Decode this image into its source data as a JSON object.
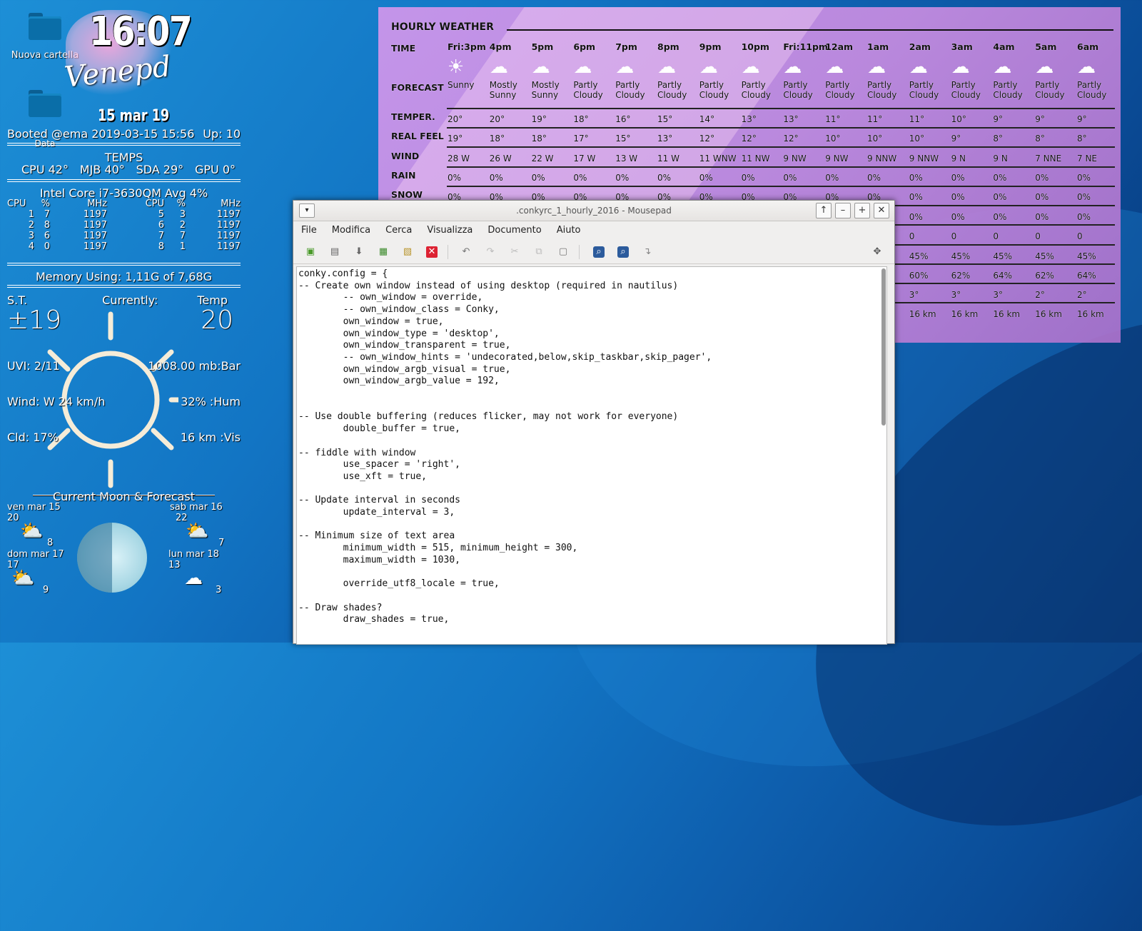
{
  "desktop": {
    "icons": [
      {
        "label": "Nuova cartella"
      },
      {
        "label": "Data"
      }
    ]
  },
  "conky_left": {
    "time": "16:07",
    "signature": "Venepd",
    "date": "15 mar 19",
    "booted": "Booted @ema 2019-03-15 15:56",
    "uptime": "Up: 10",
    "temps_title": "TEMPS",
    "temps": [
      "CPU 42°",
      "MJB 40°",
      "SDA 29°",
      "GPU 0°"
    ],
    "cpu_title": "Intel Core i7-3630QM Avg  4%",
    "cpu_headers": [
      "CPU",
      "%",
      "MHz",
      "CPU",
      "%",
      "MHz"
    ],
    "cpu_rows": [
      [
        "1",
        "7",
        "1197",
        "5",
        "3",
        "1197"
      ],
      [
        "2",
        "8",
        "1197",
        "6",
        "2",
        "1197"
      ],
      [
        "3",
        "6",
        "1197",
        "7",
        "7",
        "1197"
      ],
      [
        "4",
        "0",
        "1197",
        "8",
        "1",
        "1197"
      ]
    ],
    "memory": "Memory  Using: 1,11G of 7,68G",
    "weather": {
      "st_label": "S.T.",
      "currently_label": "Currently:",
      "temp_label": "Temp",
      "st_value": "±19",
      "temp_value": "20",
      "uvi": "UVI: 2/11",
      "pressure": "1008.00 mb:Bar",
      "wind": "Wind: W 24 km/h",
      "humidity": "32% :Hum",
      "cloud": "Cld: 17%",
      "visibility": "16 km :Vis"
    },
    "moon_title": "Current Moon & Forecast",
    "forecast": [
      {
        "day": "ven mar 15",
        "high": "20",
        "low": "8"
      },
      {
        "day": "sab mar 16",
        "high": "22",
        "low": "7"
      },
      {
        "day": "dom mar 17",
        "high": "17",
        "low": "9"
      },
      {
        "day": "lun mar 18",
        "high": "13",
        "low": "3"
      }
    ]
  },
  "hourly": {
    "title": "HOURLY WEATHER",
    "labels": [
      "TIME",
      "FORECAST",
      "TEMPER.",
      "REAL FEEL",
      "WIND",
      "RAIN",
      "SNOW"
    ],
    "hours": [
      {
        "time": "Fri:3pm",
        "fc1": "Sunny",
        "fc2": "",
        "temp": "20°",
        "feel": "19°",
        "wind": "28 W",
        "rain": "0%",
        "snow": "0%"
      },
      {
        "time": "4pm",
        "fc1": "Mostly",
        "fc2": "Sunny",
        "temp": "20°",
        "feel": "18°",
        "wind": "26 W",
        "rain": "0%",
        "snow": "0%"
      },
      {
        "time": "5pm",
        "fc1": "Mostly",
        "fc2": "Sunny",
        "temp": "19°",
        "feel": "18°",
        "wind": "22 W",
        "rain": "0%",
        "snow": "0%"
      },
      {
        "time": "6pm",
        "fc1": "Partly",
        "fc2": "Cloudy",
        "temp": "18°",
        "feel": "17°",
        "wind": "17 W",
        "rain": "0%",
        "snow": "0%"
      },
      {
        "time": "7pm",
        "fc1": "Partly",
        "fc2": "Cloudy",
        "temp": "16°",
        "feel": "15°",
        "wind": "13 W",
        "rain": "0%",
        "snow": "0%"
      },
      {
        "time": "8pm",
        "fc1": "Partly",
        "fc2": "Cloudy",
        "temp": "15°",
        "feel": "13°",
        "wind": "11 W",
        "rain": "0%",
        "snow": "0%"
      },
      {
        "time": "9pm",
        "fc1": "Partly",
        "fc2": "Cloudy",
        "temp": "14°",
        "feel": "12°",
        "wind": "11 WNW",
        "rain": "0%",
        "snow": "0%"
      },
      {
        "time": "10pm",
        "fc1": "Partly",
        "fc2": "Cloudy",
        "temp": "13°",
        "feel": "12°",
        "wind": "11 NW",
        "rain": "0%",
        "snow": "0%"
      },
      {
        "time": "Fri:11pm",
        "fc1": "Partly",
        "fc2": "Cloudy",
        "temp": "13°",
        "feel": "12°",
        "wind": "9 NW",
        "rain": "0%",
        "snow": "0%"
      },
      {
        "time": "12am",
        "fc1": "Partly",
        "fc2": "Cloudy",
        "temp": "11°",
        "feel": "10°",
        "wind": "9 NW",
        "rain": "0%",
        "snow": "0%"
      },
      {
        "time": "1am",
        "fc1": "Partly",
        "fc2": "Cloudy",
        "temp": "11°",
        "feel": "10°",
        "wind": "9 NNW",
        "rain": "0%",
        "snow": "0%"
      },
      {
        "time": "2am",
        "fc1": "Partly",
        "fc2": "Cloudy",
        "temp": "11°",
        "feel": "10°",
        "wind": "9 NNW",
        "rain": "0%",
        "snow": "0%",
        "r8": "0%",
        "r9": "0",
        "r10": "45%",
        "r11": "60%",
        "r12": "3°",
        "r13": "16 km"
      },
      {
        "time": "3am",
        "fc1": "Partly",
        "fc2": "Cloudy",
        "temp": "10°",
        "feel": "9°",
        "wind": "9 N",
        "rain": "0%",
        "snow": "0%",
        "r8": "0%",
        "r9": "0",
        "r10": "45%",
        "r11": "62%",
        "r12": "3°",
        "r13": "16 km"
      },
      {
        "time": "4am",
        "fc1": "Partly",
        "fc2": "Cloudy",
        "temp": "9°",
        "feel": "8°",
        "wind": "9 N",
        "rain": "0%",
        "snow": "0%",
        "r8": "0%",
        "r9": "0",
        "r10": "45%",
        "r11": "64%",
        "r12": "3°",
        "r13": "16 km"
      },
      {
        "time": "5am",
        "fc1": "Partly",
        "fc2": "Cloudy",
        "temp": "9°",
        "feel": "8°",
        "wind": "7 NNE",
        "rain": "0%",
        "snow": "0%",
        "r8": "0%",
        "r9": "0",
        "r10": "45%",
        "r11": "62%",
        "r12": "2°",
        "r13": "16 km"
      },
      {
        "time": "6am",
        "fc1": "Partly",
        "fc2": "Cloudy",
        "temp": "9°",
        "feel": "8°",
        "wind": "7 NE",
        "rain": "0%",
        "snow": "0%",
        "r8": "0%",
        "r9": "0",
        "r10": "45%",
        "r11": "64%",
        "r12": "2°",
        "r13": "16 km"
      }
    ]
  },
  "mousepad": {
    "title": ".conkyrc_1_hourly_2016 - Mousepad",
    "menu": [
      "File",
      "Modifica",
      "Cerca",
      "Visualizza",
      "Documento",
      "Aiuto"
    ],
    "content": "conky.config = {\n-- Create own window instead of using desktop (required in nautilus)\n        -- own_window = override,\n        -- own_window_class = Conky,\n        own_window = true,\n        own_window_type = 'desktop',\n        own_window_transparent = true,\n        -- own_window_hints = 'undecorated,below,skip_taskbar,skip_pager',\n        own_window_argb_visual = true,\n        own_window_argb_value = 192,\n\n\n-- Use double buffering (reduces flicker, may not work for everyone)\n        double_buffer = true,\n\n-- fiddle with window\n        use_spacer = 'right',\n        use_xft = true,\n\n-- Update interval in seconds\n        update_interval = 3,\n\n-- Minimum size of text area\n        minimum_width = 515, minimum_height = 300,\n        maximum_width = 1030,\n\n        override_utf8_locale = true,\n\n-- Draw shades?\n        draw_shades = true,"
  }
}
